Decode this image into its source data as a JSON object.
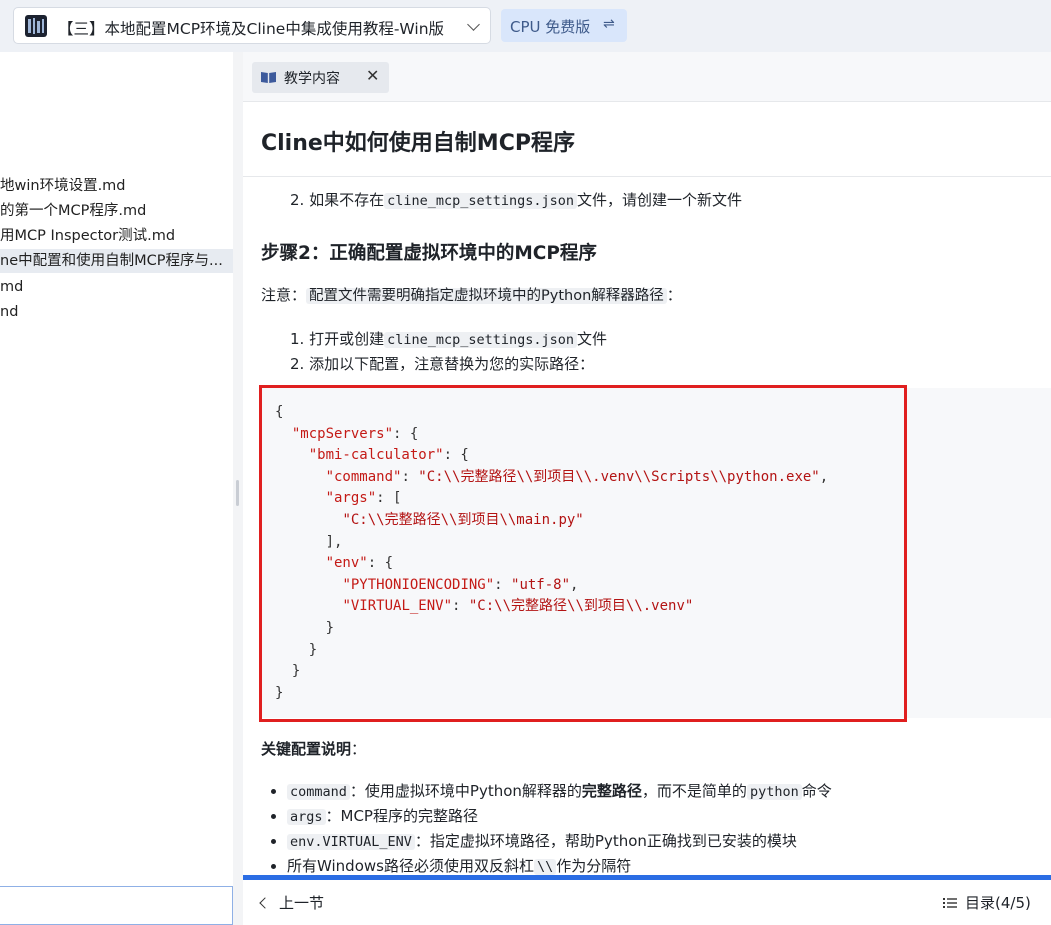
{
  "topbar": {
    "course_title": "【三】本地配置MCP环境及Cline中集成使用教程-Win版",
    "cpu_label": "CPU 免费版",
    "swap_glyph": "⇌"
  },
  "sidebar": {
    "items": [
      {
        "label": "地win环境设置.md"
      },
      {
        "label": "的第一个MCP程序.md"
      },
      {
        "label": "用MCP Inspector测试.md"
      },
      {
        "label": "ne中配置和使用自制MCP程序与..."
      },
      {
        "label": "md"
      },
      {
        "label": "nd"
      }
    ],
    "active_index": 3
  },
  "tab": {
    "label": "教学内容",
    "close_glyph": "✕"
  },
  "page": {
    "title": "Cline中如何使用自制MCP程序"
  },
  "content": {
    "step_prev": {
      "num": "2.",
      "pre": "如果不存在",
      "code": "cline_mcp_settings.json",
      "post": "文件，请创建一个新文件"
    },
    "step2_heading": "步骤2：正确配置虚拟环境中的MCP程序",
    "note": {
      "label": "注意：",
      "text": "配置文件需要明确指定虚拟环境中的Python解释器路径",
      "tail": "："
    },
    "ol": [
      {
        "num": "1.",
        "pre": "打开或创建",
        "code": "cline_mcp_settings.json",
        "post": "文件"
      },
      {
        "num": "2.",
        "pre": "添加以下配置，注意替换为您的实际路径：",
        "code": "",
        "post": ""
      }
    ],
    "code_lines": [
      "{",
      "  \"mcpServers\": {",
      "    \"bmi-calculator\": {",
      "      \"command\": \"C:\\\\完整路径\\\\到项目\\\\.venv\\\\Scripts\\\\python.exe\",",
      "      \"args\": [",
      "        \"C:\\\\完整路径\\\\到项目\\\\main.py\"",
      "      ],",
      "      \"env\": {",
      "        \"PYTHONIOENCODING\": \"utf-8\",",
      "        \"VIRTUAL_ENV\": \"C:\\\\完整路径\\\\到项目\\\\.venv\"",
      "      }",
      "    }",
      "  }",
      "}"
    ],
    "key_config_heading": "关键配置说明",
    "key_config_colon": "：",
    "bullets": [
      {
        "code": "command",
        "text_a": "：使用虚拟环境中Python解释器的",
        "bold": "完整路径",
        "text_b": "，而不是简单的",
        "code2": "python",
        "text_c": "命令"
      },
      {
        "code": "args",
        "text_a": "：MCP程序的完整路径",
        "bold": "",
        "text_b": "",
        "code2": "",
        "text_c": ""
      },
      {
        "code": "env.VIRTUAL_ENV",
        "text_a": "：指定虚拟环境路径，帮助Python正确找到已安装的模块",
        "bold": "",
        "text_b": "",
        "code2": "",
        "text_c": ""
      },
      {
        "code": "",
        "text_a": "所有Windows路径必须使用双反斜杠",
        "bold": "",
        "text_b": "",
        "code2": "\\\\",
        "text_c": "作为分隔符"
      }
    ]
  },
  "bottom": {
    "prev_label": "上一节",
    "toc_label": "目录(4/5)"
  },
  "colors": {
    "accent": "#2b6de4",
    "highlight_border": "#e01f1f",
    "code_key": "#c41a16"
  }
}
